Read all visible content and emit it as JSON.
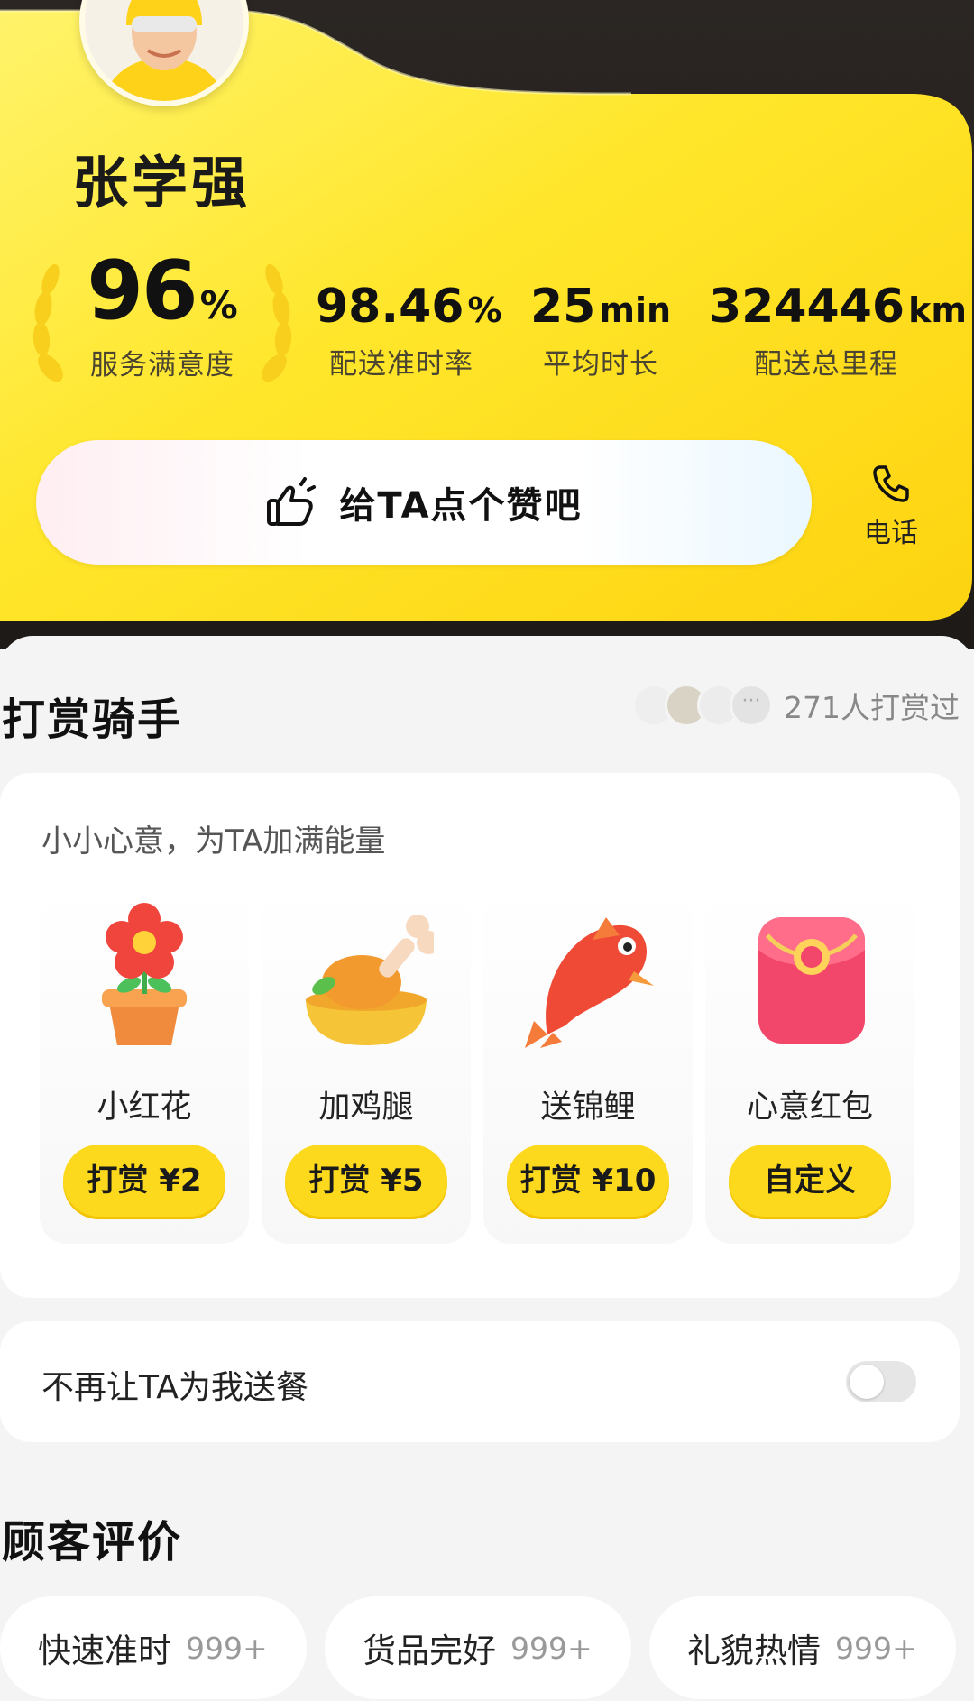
{
  "rider": {
    "name": "张学强"
  },
  "stats": [
    {
      "value": "96",
      "unit": "%",
      "label": "服务满意度"
    },
    {
      "value": "98.46",
      "unit": "%",
      "label": "配送准时率"
    },
    {
      "value": "25",
      "unit": "min",
      "label": "平均时长"
    },
    {
      "value": "324446",
      "unit": "km",
      "label": "配送总里程"
    }
  ],
  "actions": {
    "like_label": "给TA点个赞吧",
    "phone_label": "电话"
  },
  "tips": {
    "title": "打赏骑手",
    "tipper_count": "271人打赏过",
    "subtitle": "小小心意，为TA加满能量",
    "gifts": [
      {
        "name": "小红花",
        "button": "打赏 ¥2",
        "icon": "flower-icon"
      },
      {
        "name": "加鸡腿",
        "button": "打赏 ¥5",
        "icon": "chicken-leg-icon"
      },
      {
        "name": "送锦鲤",
        "button": "打赏 ¥10",
        "icon": "koi-fish-icon"
      },
      {
        "name": "心意红包",
        "button": "自定义",
        "icon": "red-envelope-icon"
      }
    ]
  },
  "preference": {
    "label": "不再让TA为我送餐",
    "enabled": false
  },
  "reviews": {
    "title": "顾客评价",
    "tags": [
      {
        "label": "快速准时",
        "count": "999+"
      },
      {
        "label": "货品完好",
        "count": "999+"
      },
      {
        "label": "礼貌热情",
        "count": "999+"
      }
    ]
  },
  "colors": {
    "brand_yellow": "#FCD91D",
    "toggle_off": "#E6E6E6"
  }
}
